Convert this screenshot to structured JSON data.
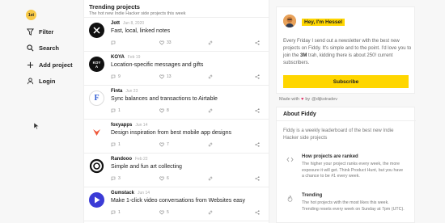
{
  "sidebar": {
    "logo": "1st",
    "items": [
      {
        "label": "Filter",
        "icon": "filter-icon"
      },
      {
        "label": "Search",
        "icon": "search-icon"
      },
      {
        "label": "Add project",
        "icon": "plus-icon"
      },
      {
        "label": "Login",
        "icon": "user-icon"
      }
    ]
  },
  "feed": {
    "title": "Trending projects",
    "subtitle": "The hot new Indie Hacker side projects this week",
    "items": [
      {
        "name": "Jott",
        "date": "Jun 8, 2020",
        "desc": "Fast, local, linked notes",
        "comments": "",
        "likes": "33",
        "thumb": "JOTT",
        "thumb_color": "#111111"
      },
      {
        "name": "KOYA",
        "date": "Feb 19",
        "desc": "Location-specific messages and gifts",
        "comments": "9",
        "likes": "13",
        "thumb": "KOYA",
        "thumb_color": "#111111"
      },
      {
        "name": "Finta",
        "date": "Jun 23",
        "desc": "Sync balances and transactions to Airtable",
        "comments": "1",
        "likes": "8",
        "thumb": "F",
        "thumb_color": "#ffffff"
      },
      {
        "name": "foxyapps",
        "date": "Jun 14",
        "desc": "Design inspiration from best mobile app designs",
        "comments": "1",
        "likes": "7",
        "thumb": "fox",
        "thumb_color": "#ffffff"
      },
      {
        "name": "Randooo",
        "date": "Feb 22",
        "desc": "Simple and fun art collecting",
        "comments": "3",
        "likes": "6",
        "thumb": "R",
        "thumb_color": "#ffffff"
      },
      {
        "name": "Gumstack",
        "date": "Jun 14",
        "desc": "Make 1-click video conversations from Websites easy",
        "comments": "1",
        "likes": "5",
        "thumb": "G",
        "thumb_color": "#3b3bd6"
      }
    ]
  },
  "newsletter": {
    "greeting": "Hey, I'm Hessel",
    "text_before": "Every Friday I send out a newsletter with the best new projects on Fiddy. It's simple and to the point. I'd love you to join the ",
    "subscribers": "3M",
    "text_after": " trah, kidding there is about 250! current subscribers.",
    "button": "Subscribe"
  },
  "madeby": {
    "prefix": "Made with",
    "heart": "♥",
    "by": "by",
    "handle": "@dijkstradev"
  },
  "about": {
    "title": "About Fiddy",
    "text": "Fiddy is a weekly leaderboard of the best new Indie Hacker side projects",
    "features": [
      {
        "title": "How projects are ranked",
        "text": "The higher your project ranks every week, the more exposure it will get. Think Product Hunt, but you have a chance to be #1 every week."
      },
      {
        "title": "Trending",
        "text": "The hot projects with the most likes this week. Trending resets every week on Sunday at 7pm (UTC)."
      }
    ]
  },
  "colors": {
    "accent": "#ffd600",
    "logo": "#f7c948"
  }
}
